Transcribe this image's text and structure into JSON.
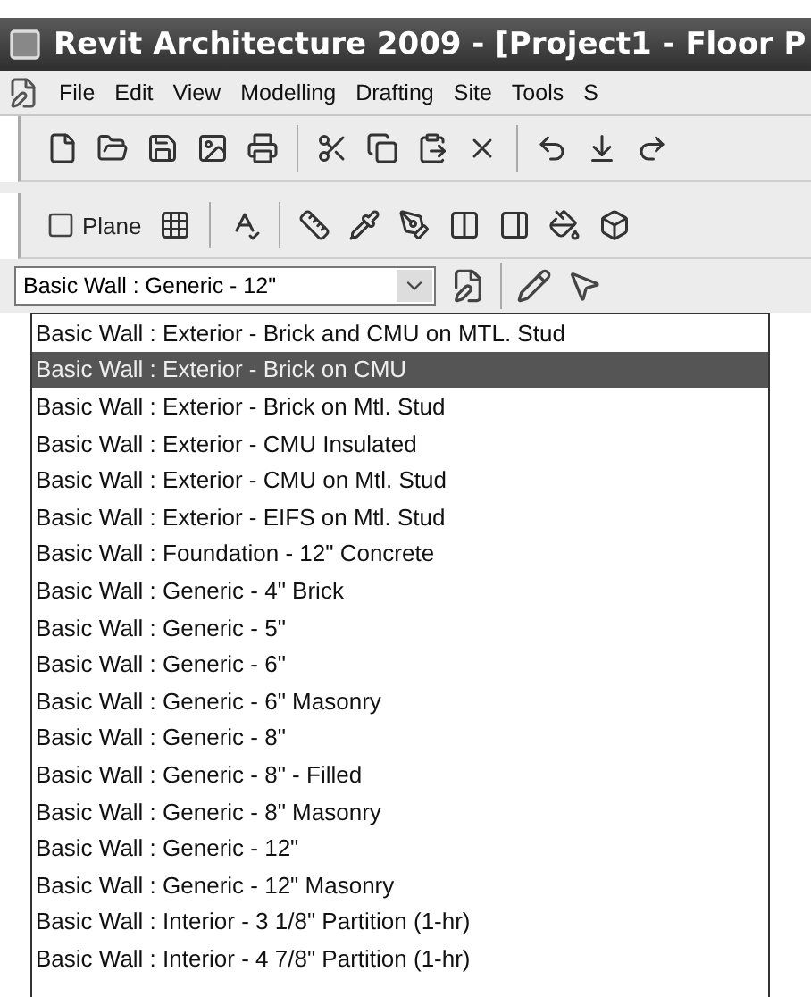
{
  "window": {
    "title": "Revit Architecture 2009 - [Project1 - Floor P"
  },
  "menu": [
    "File",
    "Edit",
    "View",
    "Modelling",
    "Drafting",
    "Site",
    "Tools",
    "S"
  ],
  "toolbar_2": {
    "plane_button": "Plane"
  },
  "type_selector": {
    "value": "Basic Wall : Generic - 12\""
  },
  "type_list": [
    {
      "label": "Basic Wall : Exterior - Brick and CMU on MTL. Stud",
      "selected": false
    },
    {
      "label": "Basic Wall : Exterior - Brick on CMU",
      "selected": true
    },
    {
      "label": "Basic Wall : Exterior - Brick on Mtl. Stud",
      "selected": false
    },
    {
      "label": "Basic Wall : Exterior - CMU Insulated",
      "selected": false
    },
    {
      "label": "Basic Wall : Exterior - CMU on Mtl. Stud",
      "selected": false
    },
    {
      "label": "Basic Wall : Exterior - EIFS on Mtl. Stud",
      "selected": false
    },
    {
      "label": "Basic Wall : Foundation - 12\" Concrete",
      "selected": false
    },
    {
      "label": "Basic Wall : Generic - 4\" Brick",
      "selected": false
    },
    {
      "label": "Basic Wall : Generic - 5\"",
      "selected": false
    },
    {
      "label": "Basic Wall : Generic - 6\"",
      "selected": false
    },
    {
      "label": "Basic Wall : Generic - 6\" Masonry",
      "selected": false
    },
    {
      "label": "Basic Wall : Generic - 8\"",
      "selected": false
    },
    {
      "label": "Basic Wall : Generic - 8\" - Filled",
      "selected": false
    },
    {
      "label": "Basic Wall : Generic - 8\" Masonry",
      "selected": false
    },
    {
      "label": "Basic Wall : Generic - 12\"",
      "selected": false
    },
    {
      "label": "Basic Wall : Generic - 12\" Masonry",
      "selected": false
    },
    {
      "label": "Basic Wall : Interior - 3 1/8\" Partition (1-hr)",
      "selected": false
    },
    {
      "label": "Basic Wall : Interior - 4 7/8\" Partition (1-hr)",
      "selected": false
    }
  ]
}
